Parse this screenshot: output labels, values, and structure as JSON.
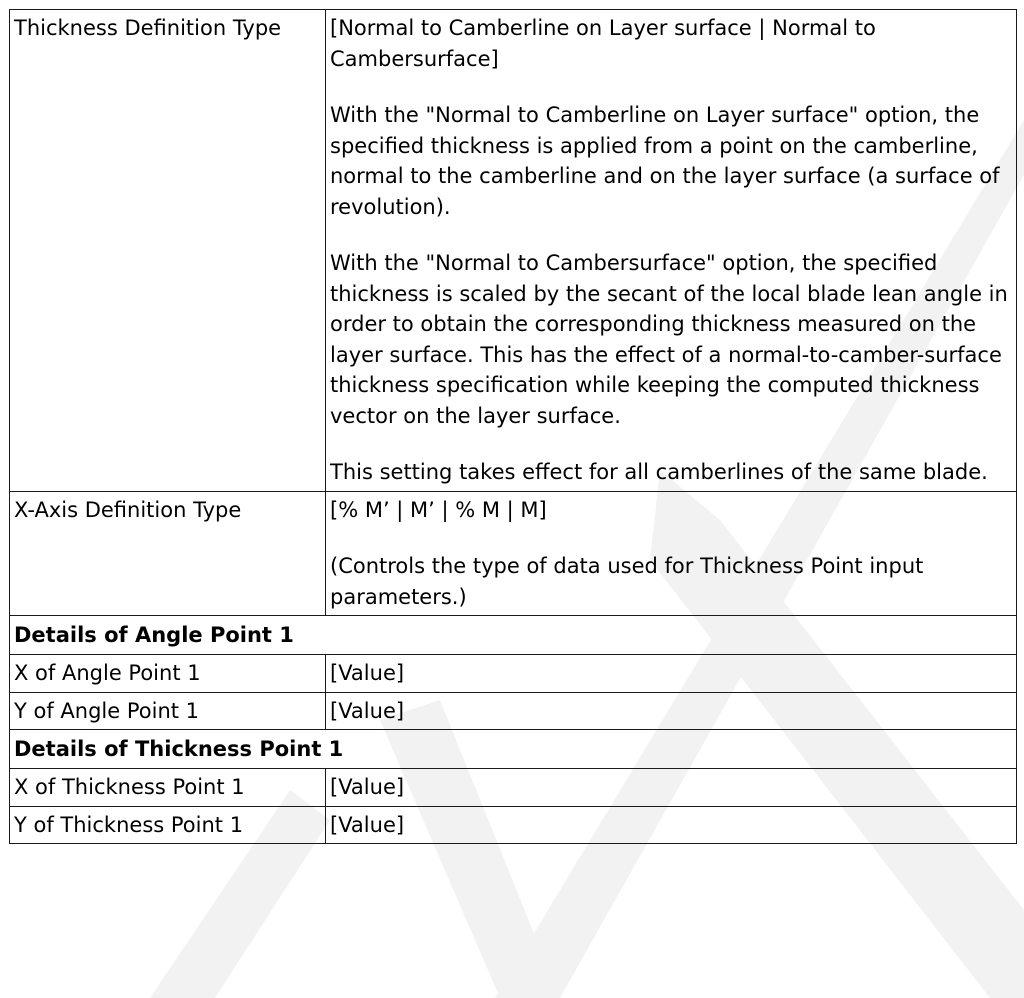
{
  "rows": {
    "thickness_definition_type": {
      "label": "Thickness Definition Type",
      "value_options": "[Normal to Camberline on Layer surface | Normal to Cambersurface]",
      "desc_1": "With the \"Normal to Camberline on Layer surface\" option, the specified thickness is applied from a point on the camberline, normal to the camberline and on the layer surface (a surface of revolution).",
      "desc_2": "With the \"Normal to Cambersurface\" option, the specified thickness is scaled by the secant of the local blade lean angle in order to obtain the corresponding thickness measured on the layer surface. This has the effect of a normal-to-camber-surface thickness specification while keeping the computed thickness vector on the layer surface.",
      "desc_3": "This setting takes effect for all camberlines of the same blade."
    },
    "x_axis_definition_type": {
      "label": "X-Axis Definition Type",
      "value_options": "[% M’ | M’ | % M | M]",
      "desc_1": "(Controls the type of data used for Thickness Point input parameters.)"
    },
    "section_angle_point": "Details of Angle Point 1",
    "x_angle_point": {
      "label": "X of Angle Point 1",
      "value": "[Value]"
    },
    "y_angle_point": {
      "label": "Y of Angle Point 1",
      "value": "[Value]"
    },
    "section_thickness_point": "Details of Thickness Point 1",
    "x_thickness_point": {
      "label": "X of Thickness Point 1",
      "value": "[Value]"
    },
    "y_thickness_point": {
      "label": "Y of Thickness Point 1",
      "value": "[Value]"
    }
  },
  "watermark_color": "#f2f2f2"
}
